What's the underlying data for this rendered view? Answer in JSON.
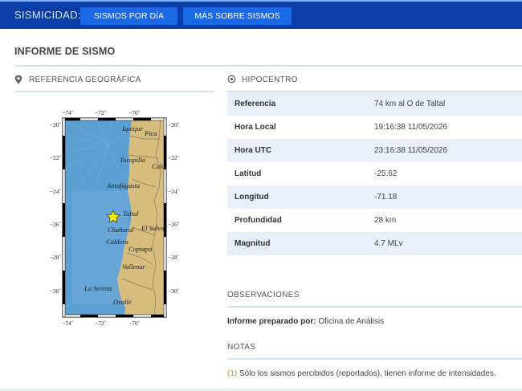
{
  "nav": {
    "label": "SISMICIDAD:",
    "buttons": [
      "SISMOS POR DÍA",
      "MÁS SOBRE SISMOS"
    ]
  },
  "page_title": "INFORME DE SISMO",
  "left_section": {
    "title": "REFERENCIA GEOGRÁFICA",
    "icon": "map-pin-icon"
  },
  "map": {
    "lon_ticks": [
      "−74˚",
      "−72˚",
      "−70˚"
    ],
    "lat_ticks": [
      "−20˚",
      "−22˚",
      "−24˚",
      "−26˚",
      "−28˚",
      "−30˚"
    ],
    "places": [
      "Iquique",
      "Pica",
      "Tocopilla",
      "Cala",
      "Antofagasta",
      "Taltal",
      "Chañaral",
      "El Salva",
      "Caldera",
      "Copiapó",
      "Vallenar",
      "La Serena",
      "Ovalle"
    ],
    "epicenter": {
      "lon": -70.9,
      "lat": -25.6
    },
    "colors": {
      "ocean": "#5b9fd3",
      "land": "#d7bd7d",
      "epicenter": "#ffea00"
    }
  },
  "right_section": {
    "title": "HIPOCENTRO",
    "icon": "target-icon"
  },
  "hypocenter": [
    {
      "label": "Referencia",
      "value": "74 km al O de Taltal"
    },
    {
      "label": "Hora Local",
      "value": "19:16:38 11/05/2026"
    },
    {
      "label": "Hora UTC",
      "value": "23:16:38 11/05/2026"
    },
    {
      "label": "Latitud",
      "value": "-25.62"
    },
    {
      "label": "Longitud",
      "value": "-71.18"
    },
    {
      "label": "Profundidad",
      "value": "28 km"
    },
    {
      "label": "Magnitud",
      "value": "4.7 MLv"
    }
  ],
  "observaciones": {
    "title": "OBSERVACIONES",
    "prepared_label": "Informe preparado por:",
    "prepared_value": "Oficina de Análisis"
  },
  "notas": {
    "title": "NOTAS",
    "items": [
      {
        "num": "(1)",
        "text": "Sólo los sismos percibidos (reportados), tienen informe de intensidades."
      }
    ]
  }
}
